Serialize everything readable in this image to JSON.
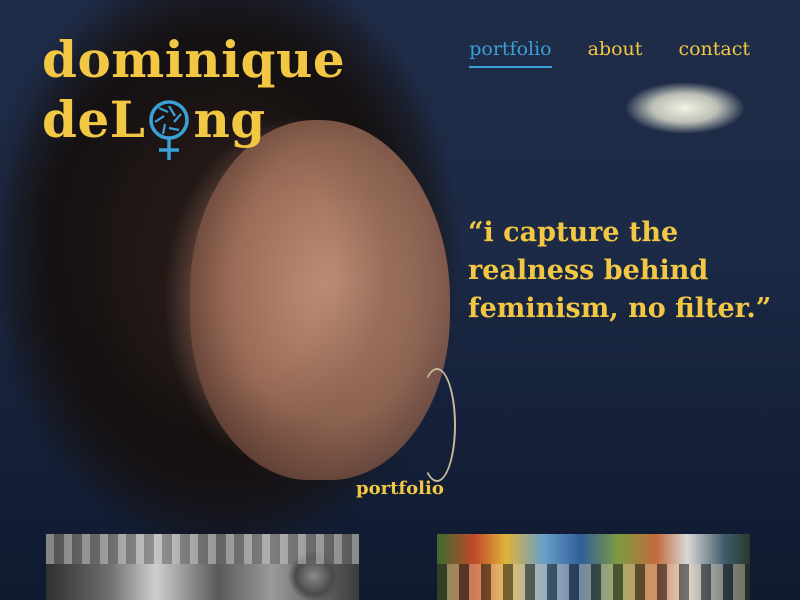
{
  "brand": {
    "line1": "dominique",
    "line2_before": "deL",
    "line2_after": "ng",
    "logo_icon": "camera-aperture-venus-icon"
  },
  "nav": {
    "items": [
      {
        "label": "portfolio",
        "active": true
      },
      {
        "label": "about",
        "active": false
      },
      {
        "label": "contact",
        "active": false
      }
    ]
  },
  "hero": {
    "quote": "“i capture the realness behind feminism, no filter.”"
  },
  "portfolio": {
    "section_title": "portfolio"
  },
  "colors": {
    "accent_yellow": "#f2c744",
    "accent_blue": "#3aa0d8",
    "background_navy": "#1c2a46"
  }
}
